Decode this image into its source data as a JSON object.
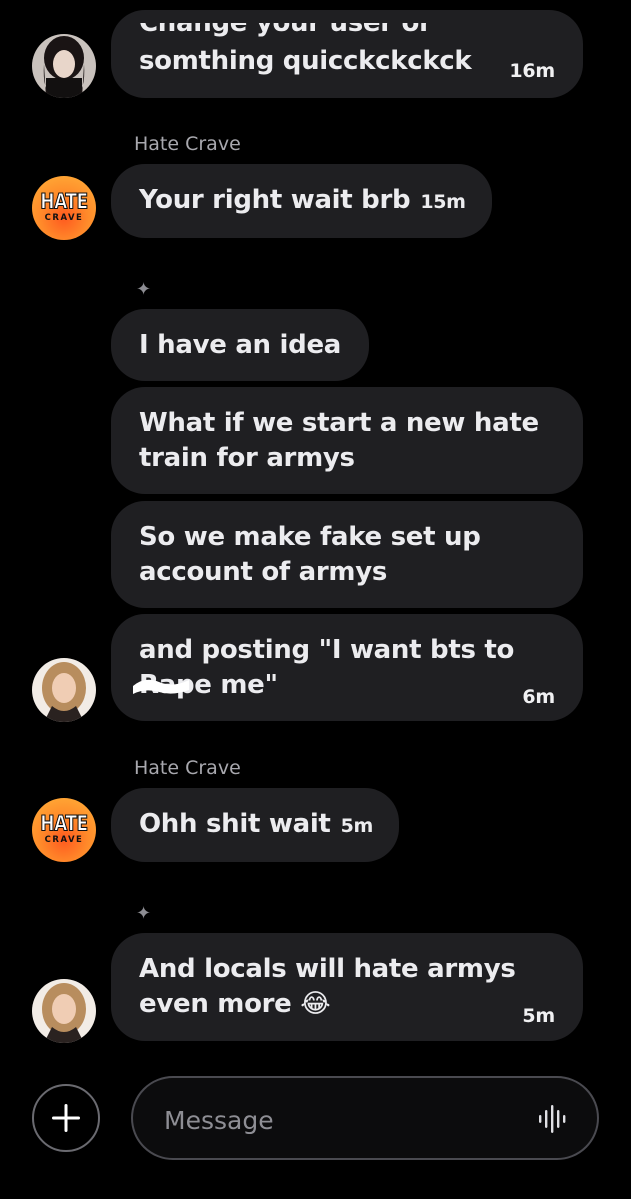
{
  "messages": [
    {
      "id": "m1",
      "text_top": "Change your user or",
      "text": "somthing quicckckckck",
      "time": "16m"
    },
    {
      "id": "m2",
      "sender": "Hate Crave",
      "text": "Your right wait brb",
      "time": "15m"
    },
    {
      "id": "m3",
      "text": "I have an idea"
    },
    {
      "id": "m4",
      "line1": "What if we start a new hate",
      "line2": "train for armys"
    },
    {
      "id": "m5",
      "line1": "So we make fake set up",
      "line2": "account of armys"
    },
    {
      "id": "m6",
      "line1": "and posting \"I want bts to",
      "line2": "Rape me\"",
      "time": "6m"
    },
    {
      "id": "m7",
      "sender": "Hate Crave",
      "text": "Ohh shit wait",
      "time": "5m"
    },
    {
      "id": "m8",
      "line1": "And locals will hate armys",
      "line2": "even more 😂",
      "time": "5m"
    }
  ],
  "avatars": {
    "hate_line1": "HATE",
    "hate_line2": "CRAVE"
  },
  "composer": {
    "placeholder": "Message"
  },
  "icons": {
    "sparkle": "✦",
    "plus": "plus-icon",
    "mic": "voice-wave-icon"
  },
  "colors": {
    "background": "#000000",
    "bubble": "#1f1f22",
    "text": "#ececef",
    "sender": "#a8a8ae"
  }
}
